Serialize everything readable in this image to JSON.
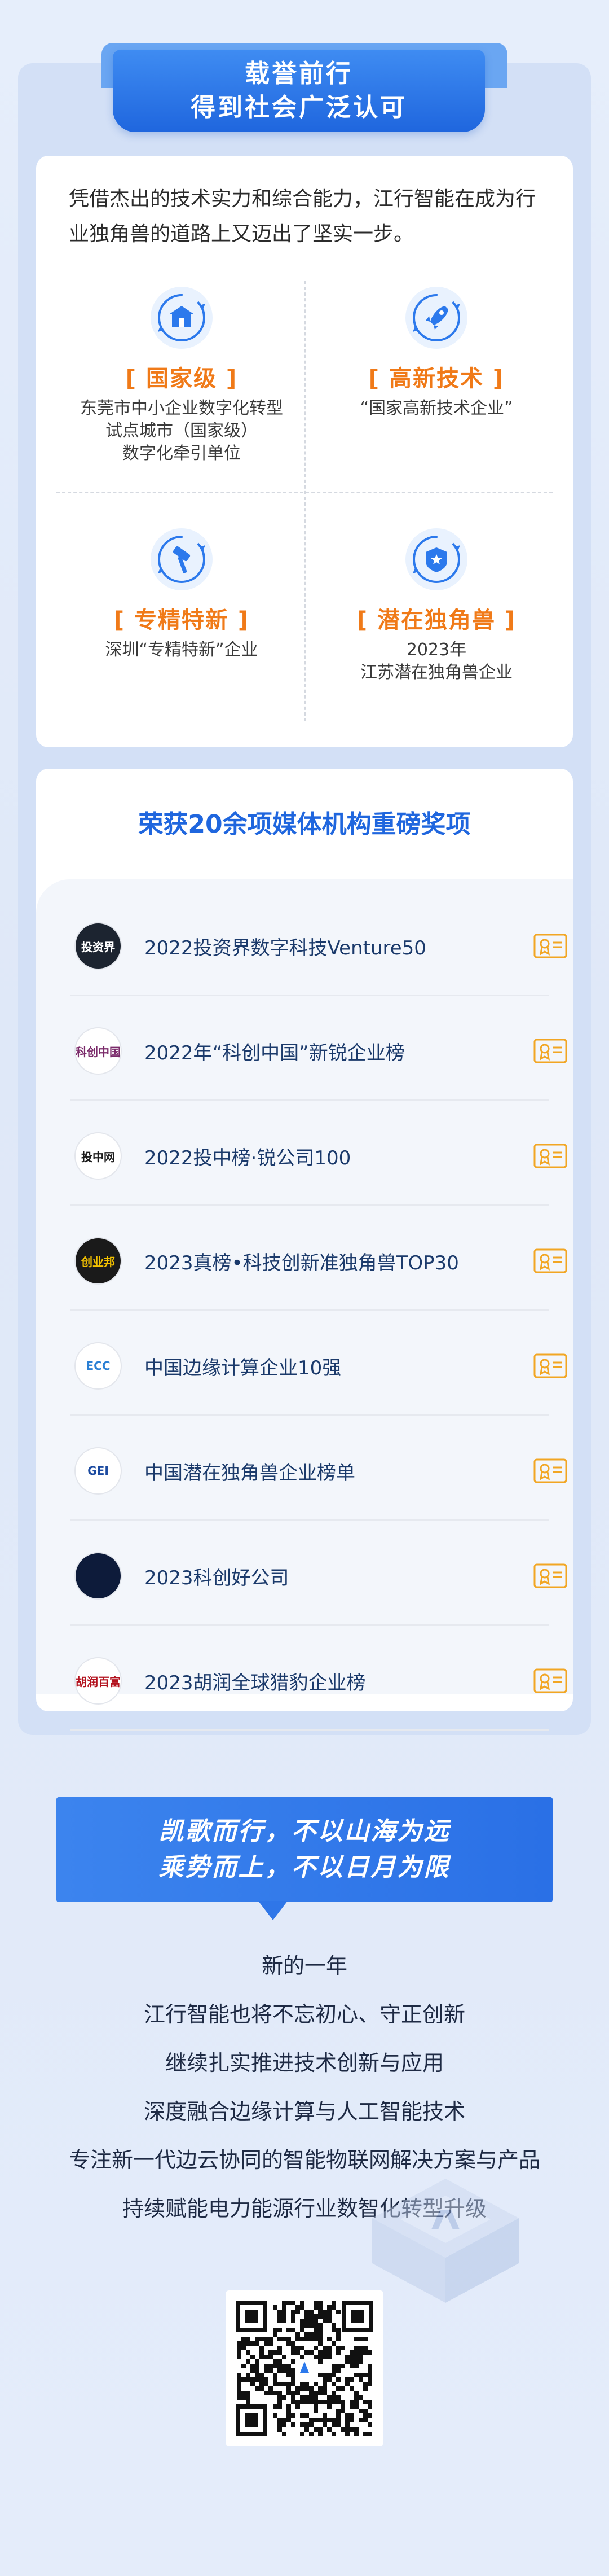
{
  "header": {
    "line1": "载誉前行",
    "line2": "得到社会广泛认可"
  },
  "intro": "凭借杰出的技术实力和综合能力，江行智能在成为行业独角兽的道路上又迈出了坚实一步。",
  "honors": [
    {
      "title": "[ 国家级 ]",
      "desc": [
        "东莞市中小企业数字化转型",
        "试点城市（国家级）",
        "数字化牵引单位"
      ],
      "icon": "building-icon"
    },
    {
      "title": "[ 高新技术 ]",
      "desc": [
        "“国家高新技术企业”"
      ],
      "icon": "rocket-icon"
    },
    {
      "title": "[ 专精特新 ]",
      "desc": [
        "深圳“专精特新”企业"
      ],
      "icon": "hammer-icon"
    },
    {
      "title": "[ 潜在独角兽 ]",
      "desc": [
        "2023年",
        "江苏潜在独角兽企业"
      ],
      "icon": "shield-star-icon"
    }
  ],
  "awards": {
    "title": "荣获20余项媒体机构重磅奖项",
    "items": [
      {
        "name": "2022投资界数字科技Venture50",
        "logo": "投资界",
        "logo_bg": "#1c2430",
        "logo_fg": "#ffffff"
      },
      {
        "name": "2022年“科创中国”新锐企业榜",
        "logo": "科创中国",
        "logo_bg": "#ffffff",
        "logo_fg": "#7a2a6a"
      },
      {
        "name": "2022投中榜·锐公司100",
        "logo": "投中网",
        "logo_bg": "#ffffff",
        "logo_fg": "#1b1b1b"
      },
      {
        "name": "2023真榜•科技创新准独角兽TOP30",
        "logo": "创业邦",
        "logo_bg": "#1a1a1a",
        "logo_fg": "#f4c200"
      },
      {
        "name": "中国边缘计算企业10强",
        "logo": "ECC",
        "logo_bg": "#ffffff",
        "logo_fg": "#2a7fd4"
      },
      {
        "name": "中国潜在独角兽企业榜单",
        "logo": "GEI",
        "logo_bg": "#ffffff",
        "logo_fg": "#1b4aa0"
      },
      {
        "name": "2023科创好公司",
        "logo": "",
        "logo_bg": "#0d1b3a",
        "logo_fg": "#ffffff"
      },
      {
        "name": "2023胡润全球猎豹企业榜",
        "logo": "胡润百富",
        "logo_bg": "#ffffff",
        "logo_fg": "#b3121e"
      }
    ]
  },
  "slogan": {
    "line1": "凯歌而行，不以山海为远",
    "line2": "乘势而上，不以日月为限"
  },
  "vision": [
    "新的一年",
    "江行智能也将不忘初心、守正创新",
    "继续扎实推进技术创新与应用",
    "深度融合边缘计算与人工智能技术",
    "专注新一代边云协同的智能物联网解决方案与产品",
    "持续赋能电力能源行业数智化转型升级"
  ],
  "colors": {
    "brand_blue": "#1f66de",
    "accent_orange": "#f07a18",
    "certificate_gold": "#f2a623"
  }
}
